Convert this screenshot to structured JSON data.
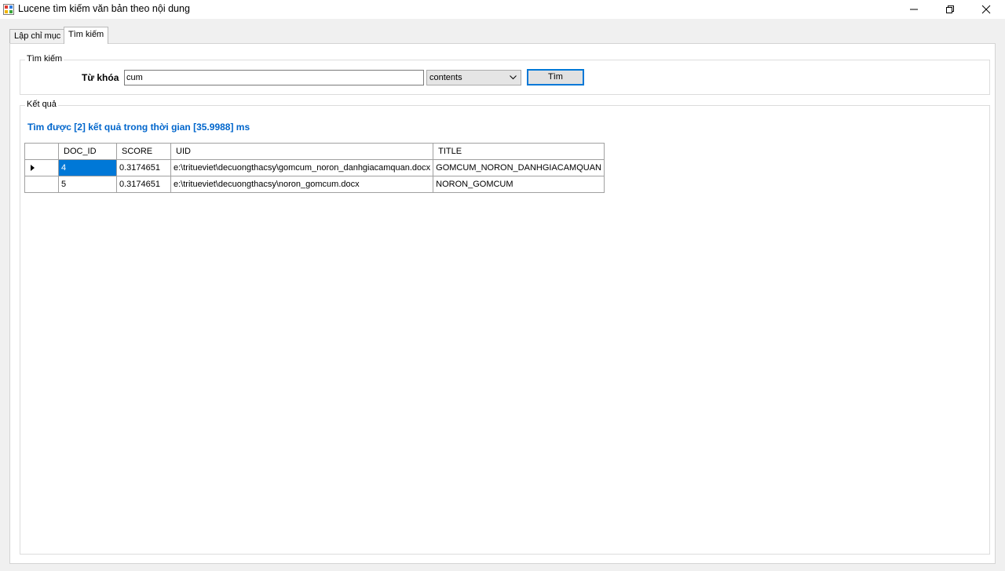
{
  "window": {
    "title": "Lucene tìm kiếm văn bản theo nội dung",
    "icon": "app-icon",
    "controls": [
      "minimize-icon",
      "restore-icon",
      "close-icon"
    ]
  },
  "tabs": [
    {
      "label": "Lập chỉ mục",
      "active": false
    },
    {
      "label": "Tìm kiếm",
      "active": true
    }
  ],
  "search_group": {
    "title": "Tìm kiếm",
    "keyword_label": "Từ khóa",
    "keyword_value": "cum",
    "field_selected": "contents",
    "search_button": "Tìm"
  },
  "results_group": {
    "title": "Kết quả",
    "status": "Tìm được [2] kết quả trong thời gian [35.9988] ms",
    "columns": [
      "DOC_ID",
      "SCORE",
      "UID",
      "TITLE"
    ],
    "rows": [
      [
        "4",
        "0.3174651",
        "e:\\tritueviet\\decuongthacsy\\gomcum_noron_danhgiacamquan.docx",
        "GOMCUM_NORON_DANHGIACAMQUAN"
      ],
      [
        "5",
        "0.3174651",
        "e:\\tritueviet\\decuongthacsy\\noron_gomcum.docx",
        "NORON_GOMCUM"
      ]
    ]
  },
  "colors": {
    "accent": "#0078d7",
    "status_text": "#0066cc"
  }
}
